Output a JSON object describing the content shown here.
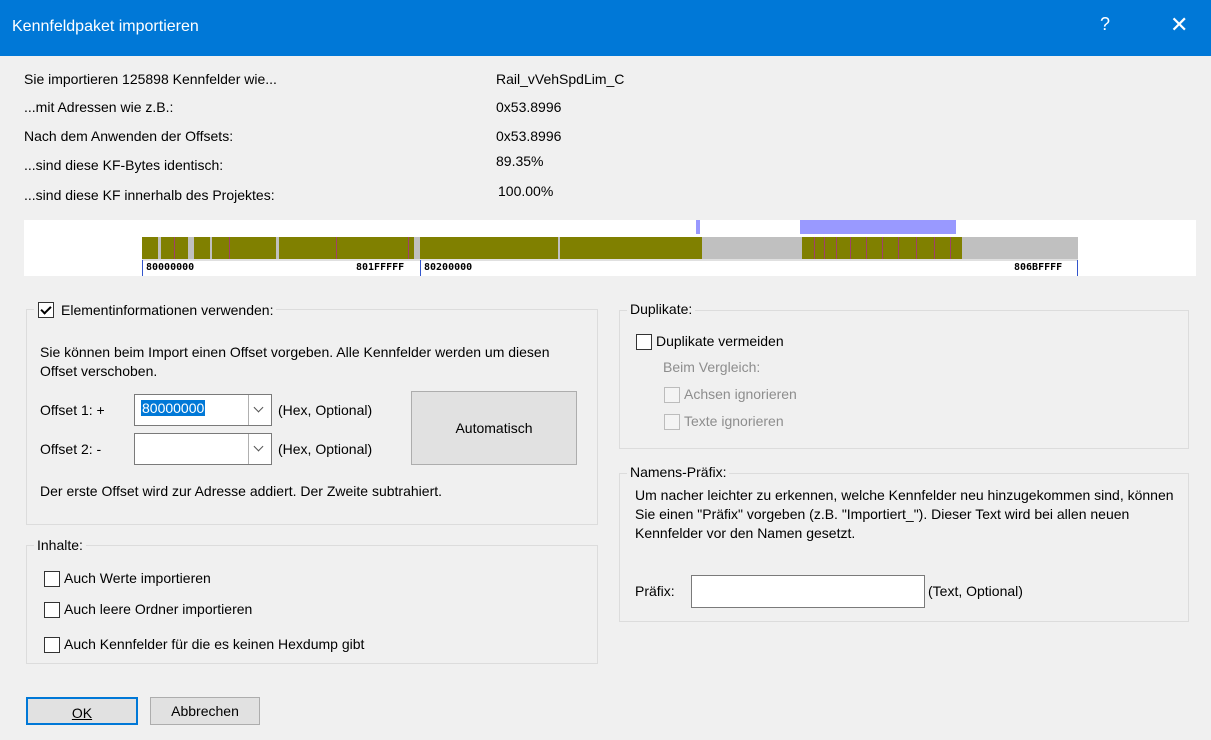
{
  "window": {
    "title": "Kennfeldpaket importieren",
    "help": "?",
    "close": "✕"
  },
  "info": {
    "rows": [
      {
        "label": "Sie importieren 125898 Kennfelder wie...",
        "value": "Rail_vVehSpdLim_C"
      },
      {
        "label": "...mit Adressen wie z.B.:",
        "value": "0x53.8996"
      },
      {
        "label": "Nach dem Anwenden der Offsets:",
        "value": "0x53.8996"
      },
      {
        "label": "...sind diese KF-Bytes identisch:",
        "value": "89.35%"
      },
      {
        "label": "...sind diese KF innerhalb des Projektes:",
        "value": "100.00%"
      }
    ]
  },
  "memory_map": {
    "labels": [
      "80000000",
      "801FFFFF",
      "80200000",
      "806BFFFF"
    ],
    "colors": {
      "data": "#808000",
      "empty": "#c0c0c0",
      "marker": "#9999ff",
      "stripe": "#a0406a"
    }
  },
  "element_info": {
    "checkbox_label": "Elementinformationen verwenden:",
    "checked": true,
    "description": "Sie können beim Import einen Offset vorgeben. Alle Kennfelder werden um diesen Offset verschoben.",
    "offset1_label": "Offset 1: +",
    "offset1_value": "80000000",
    "offset2_label": "Offset 2:  -",
    "offset2_value": "",
    "hint": "(Hex, Optional)",
    "auto_button": "Automatisch",
    "footer": "Der erste Offset wird zur Adresse addiert. Der Zweite subtrahiert."
  },
  "contents": {
    "legend": "Inhalte:",
    "items": [
      {
        "label": "Auch Werte importieren",
        "checked": false
      },
      {
        "label": "Auch leere Ordner importieren",
        "checked": false
      },
      {
        "label": "Auch Kennfelder für die es keinen Hexdump gibt",
        "checked": false
      }
    ]
  },
  "duplicates": {
    "legend": "Duplikate:",
    "avoid_label": "Duplikate vermeiden",
    "compare_label": "Beim Vergleich:",
    "ignore_axes": "Achsen ignorieren",
    "ignore_texts": "Texte ignorieren"
  },
  "prefix": {
    "legend": "Namens-Präfix:",
    "description": "Um nacher leichter zu erkennen, welche Kennfelder neu hinzugekommen sind, können Sie einen \"Präfix\" vorgeben (z.B. \"Importiert_\"). Dieser Text wird bei allen neuen Kennfelder vor den Namen gesetzt.",
    "label": "Präfix:",
    "value": "",
    "hint": "(Text, Optional)"
  },
  "buttons": {
    "ok": "OK",
    "cancel": "Abbrechen"
  }
}
